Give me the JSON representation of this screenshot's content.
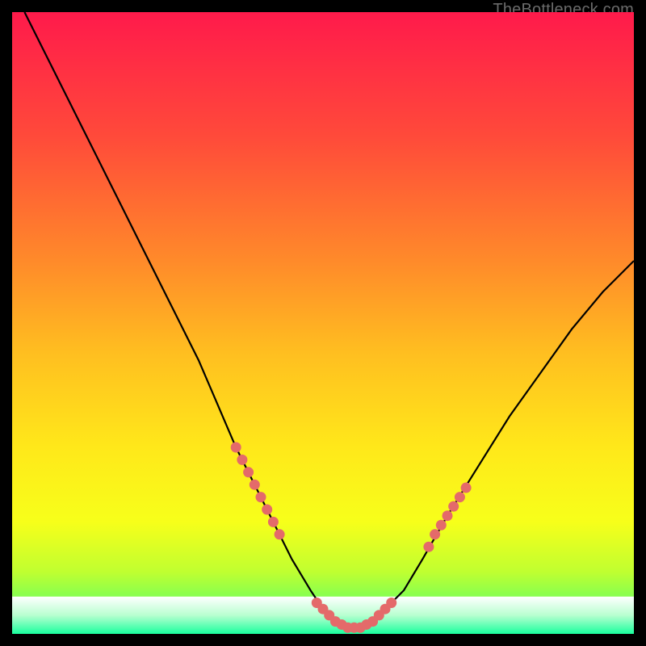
{
  "watermark": "TheBottleneck.com",
  "chart_data": {
    "type": "line",
    "title": "",
    "xlabel": "",
    "ylabel": "",
    "xlim": [
      0,
      100
    ],
    "ylim": [
      0,
      100
    ],
    "gradient_stops": [
      {
        "offset": 0.0,
        "color": "#ff1a4b"
      },
      {
        "offset": 0.2,
        "color": "#ff4a3a"
      },
      {
        "offset": 0.4,
        "color": "#ff8a2a"
      },
      {
        "offset": 0.55,
        "color": "#ffbf20"
      },
      {
        "offset": 0.7,
        "color": "#ffe81a"
      },
      {
        "offset": 0.82,
        "color": "#f7ff1a"
      },
      {
        "offset": 0.9,
        "color": "#c0ff30"
      },
      {
        "offset": 0.96,
        "color": "#6aff60"
      },
      {
        "offset": 1.0,
        "color": "#19ff9e"
      }
    ],
    "series": [
      {
        "name": "curve",
        "color": "#000000",
        "x": [
          2,
          5,
          10,
          15,
          20,
          25,
          30,
          33,
          36,
          39,
          42,
          45,
          48,
          50,
          52,
          54,
          56,
          58,
          60,
          63,
          66,
          70,
          75,
          80,
          85,
          90,
          95,
          100
        ],
        "y": [
          100,
          94,
          84,
          74,
          64,
          54,
          44,
          37,
          30,
          24,
          18,
          12,
          7,
          4,
          2,
          1,
          1,
          2,
          4,
          7,
          12,
          19,
          27,
          35,
          42,
          49,
          55,
          60
        ]
      }
    ],
    "marker_clusters": [
      {
        "name": "left-cluster",
        "color": "#e46a6a",
        "points": [
          {
            "x": 36,
            "y": 30
          },
          {
            "x": 37,
            "y": 28
          },
          {
            "x": 38,
            "y": 26
          },
          {
            "x": 39,
            "y": 24
          },
          {
            "x": 40,
            "y": 22
          },
          {
            "x": 41,
            "y": 20
          },
          {
            "x": 42,
            "y": 18
          },
          {
            "x": 43,
            "y": 16
          }
        ]
      },
      {
        "name": "bottom-cluster",
        "color": "#e46a6a",
        "points": [
          {
            "x": 49,
            "y": 5
          },
          {
            "x": 50,
            "y": 4
          },
          {
            "x": 51,
            "y": 3
          },
          {
            "x": 52,
            "y": 2
          },
          {
            "x": 53,
            "y": 1.5
          },
          {
            "x": 54,
            "y": 1
          },
          {
            "x": 55,
            "y": 1
          },
          {
            "x": 56,
            "y": 1
          },
          {
            "x": 57,
            "y": 1.5
          },
          {
            "x": 58,
            "y": 2
          },
          {
            "x": 59,
            "y": 3
          },
          {
            "x": 60,
            "y": 4
          },
          {
            "x": 61,
            "y": 5
          }
        ]
      },
      {
        "name": "right-cluster",
        "color": "#e46a6a",
        "points": [
          {
            "x": 67,
            "y": 14
          },
          {
            "x": 68,
            "y": 16
          },
          {
            "x": 69,
            "y": 17.5
          },
          {
            "x": 70,
            "y": 19
          },
          {
            "x": 71,
            "y": 20.5
          },
          {
            "x": 72,
            "y": 22
          },
          {
            "x": 73,
            "y": 23.5
          }
        ]
      }
    ],
    "bottom_band": {
      "y_from": 0,
      "y_to": 6,
      "stops": [
        {
          "offset": 0.0,
          "color": "#ffffff"
        },
        {
          "offset": 0.5,
          "color": "#b8ffd0"
        },
        {
          "offset": 1.0,
          "color": "#19ff9e"
        }
      ]
    }
  }
}
